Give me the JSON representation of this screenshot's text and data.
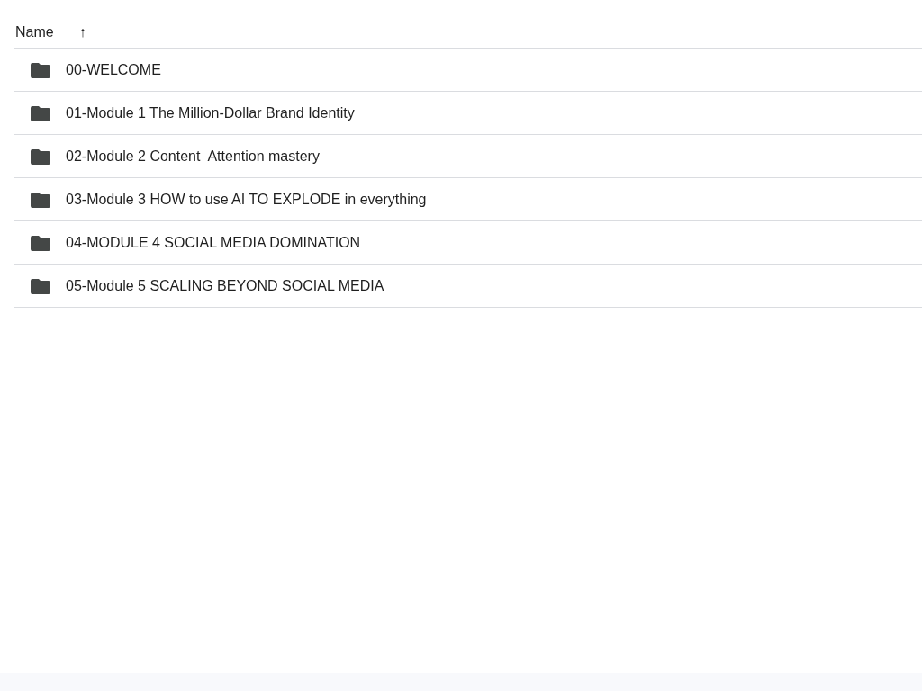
{
  "header": {
    "column": "Name",
    "sort_arrow": "↑"
  },
  "folders": [
    {
      "name": "00-WELCOME"
    },
    {
      "name": "01-Module 1 The Million-Dollar Brand Identity"
    },
    {
      "name": "02-Module 2 Content  Attention mastery"
    },
    {
      "name": "03-Module 3 HOW to use AI TO EXPLODE in everything"
    },
    {
      "name": "04-MODULE 4 SOCIAL MEDIA DOMINATION"
    },
    {
      "name": "05-Module 5 SCALING BEYOND SOCIAL MEDIA"
    }
  ]
}
